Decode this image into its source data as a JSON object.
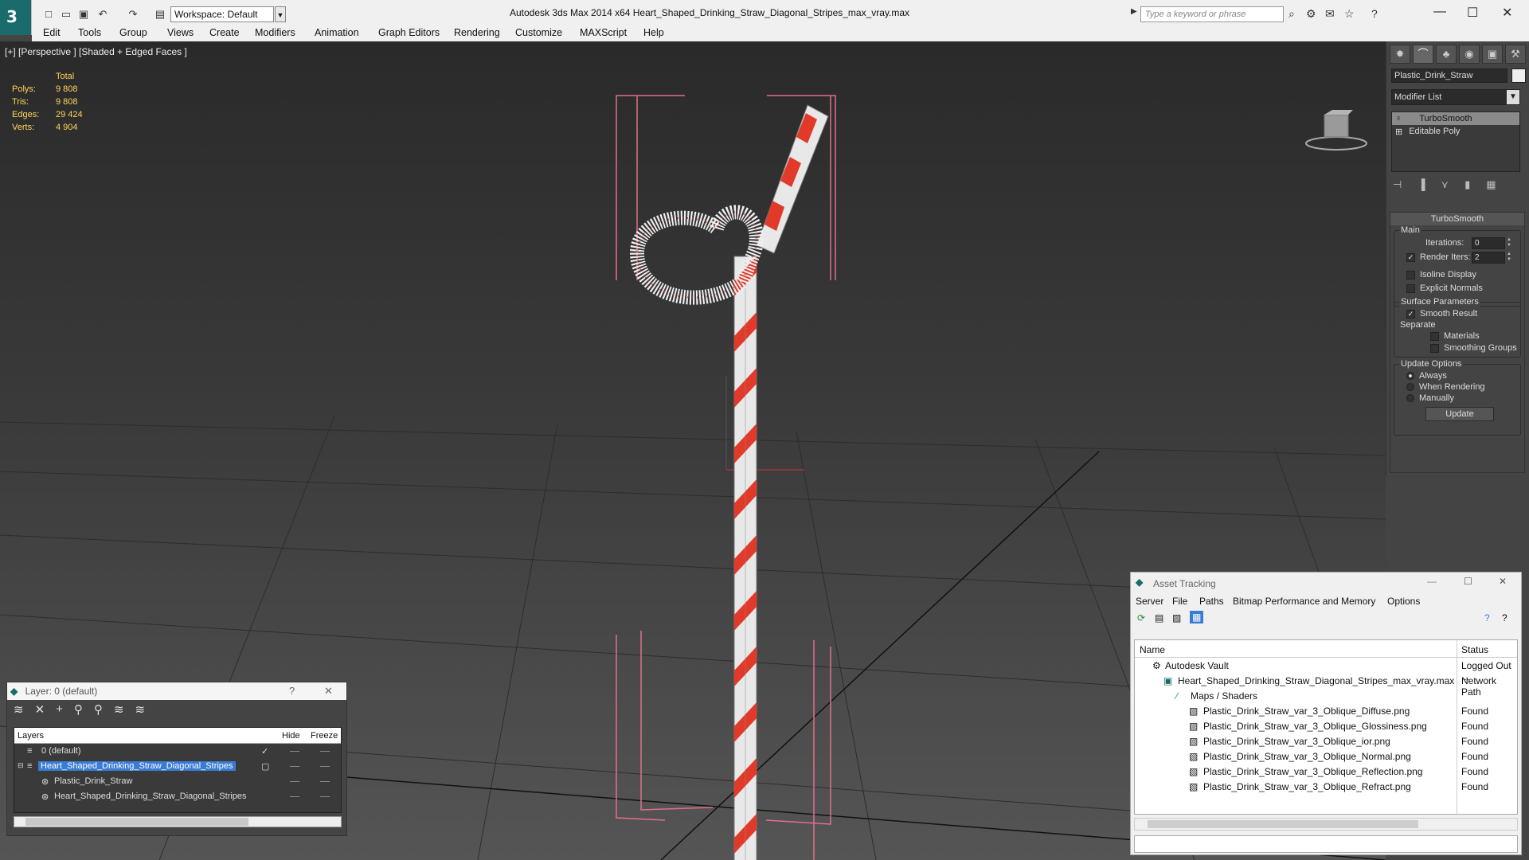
{
  "app": {
    "title": "Autodesk 3ds Max  2014 x64      Heart_Shaped_Drinking_Straw_Diagonal_Stripes_max_vray.max",
    "workspace": "Workspace: Default",
    "search_placeholder": "Type a keyword or phrase"
  },
  "menu": [
    "Edit",
    "Tools",
    "Group",
    "Views",
    "Create",
    "Modifiers",
    "Animation",
    "Graph Editors",
    "Rendering",
    "Customize",
    "MAXScript",
    "Help"
  ],
  "viewport": {
    "label": "[+] [Perspective ] [Shaded + Edged Faces ]",
    "stats_header": "Total",
    "stats": [
      {
        "k": "Polys:",
        "v": "9 808"
      },
      {
        "k": "Tris:",
        "v": "9 808"
      },
      {
        "k": "Edges:",
        "v": "29 424"
      },
      {
        "k": "Verts:",
        "v": "4 904"
      }
    ]
  },
  "command_panel": {
    "object_name": "Plastic_Drink_Straw",
    "modifier_list": "Modifier List",
    "stack": [
      "TurboSmooth",
      "Editable Poly"
    ],
    "rollout_title": "TurboSmooth",
    "main_label": "Main",
    "iterations_label": "Iterations:",
    "iterations_value": "0",
    "render_iters_label": "Render Iters:",
    "render_iters_value": "2",
    "isoline": "Isoline Display",
    "explicit_normals": "Explicit Normals",
    "surface_params": "Surface Parameters",
    "smooth_result": "Smooth Result",
    "separate": "Separate",
    "materials": "Materials",
    "smoothing_groups": "Smoothing Groups",
    "update_options": "Update Options",
    "always": "Always",
    "when_rendering": "When Rendering",
    "manually": "Manually",
    "update_button": "Update"
  },
  "layer_window": {
    "title": "Layer: 0 (default)",
    "help": "?",
    "close": "✕",
    "col_layers": "Layers",
    "col_hide": "Hide",
    "col_freeze": "Freeze",
    "rows": [
      {
        "name": "0 (default)"
      },
      {
        "name": "Heart_Shaped_Drinking_Straw_Diagonal_Stripes"
      },
      {
        "name": "Plastic_Drink_Straw"
      },
      {
        "name": "Heart_Shaped_Drinking_Straw_Diagonal_Stripes"
      }
    ]
  },
  "asset_tracking": {
    "title": "Asset Tracking",
    "menu": [
      "Server",
      "File",
      "Paths",
      "Bitmap Performance and Memory",
      "Options"
    ],
    "col_name": "Name",
    "col_status": "Status",
    "rows": [
      {
        "name": "Autodesk Vault",
        "status": "Logged Out ..."
      },
      {
        "name": "Heart_Shaped_Drinking_Straw_Diagonal_Stripes_max_vray.max",
        "status": "Network Path"
      },
      {
        "name": "Maps / Shaders",
        "status": ""
      },
      {
        "name": "Plastic_Drink_Straw_var_3_Oblique_Diffuse.png",
        "status": "Found"
      },
      {
        "name": "Plastic_Drink_Straw_var_3_Oblique_Glossiness.png",
        "status": "Found"
      },
      {
        "name": "Plastic_Drink_Straw_var_3_Oblique_ior.png",
        "status": "Found"
      },
      {
        "name": "Plastic_Drink_Straw_var_3_Oblique_Normal.png",
        "status": "Found"
      },
      {
        "name": "Plastic_Drink_Straw_var_3_Oblique_Reflection.png",
        "status": "Found"
      },
      {
        "name": "Plastic_Drink_Straw_var_3_Oblique_Refract.png",
        "status": "Found"
      }
    ]
  }
}
